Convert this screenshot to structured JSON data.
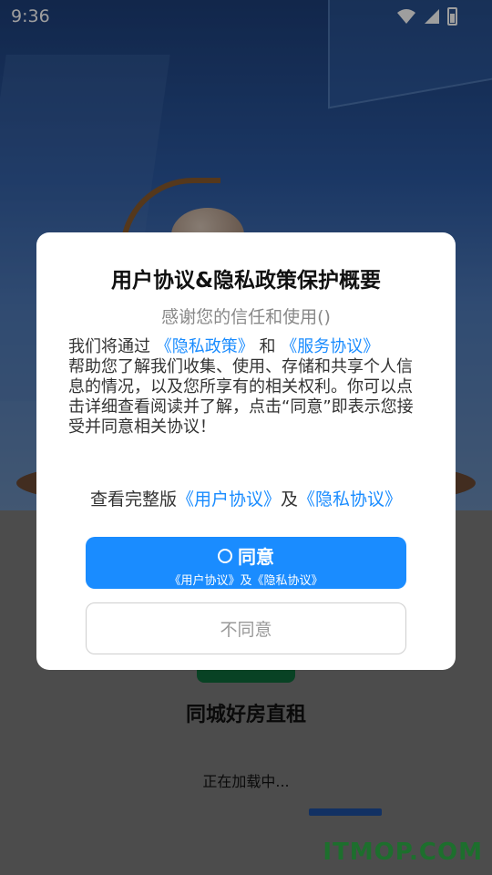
{
  "status_bar": {
    "time": "9:36",
    "icons": [
      "wifi-icon",
      "signal-icon",
      "battery-icon"
    ]
  },
  "splash": {
    "app_name": "同城好房直租",
    "loading_text": "正在加载中...",
    "loading_progress": 0.5
  },
  "dialog": {
    "title": "用户协议&隐私政策保护概要",
    "subtitle": "感谢您的信任和使用()",
    "body_prefix": "我们将通过",
    "privacy_policy_link": "《隐私政策》",
    "and_text": "和",
    "service_agreement_link": "《服务协议》",
    "body_rest": "帮助您了解我们收集、使用、存储和共享个人信息的情况，以及您所享有的相关权利。你可以点击详细查看阅读并了解，点击“同意”即表示您接受并同意相关协议！",
    "more_prefix": "查看完整版",
    "user_agreement_link": "《用户协议》",
    "more_and": "及",
    "privacy_agreement_link": "《隐私协议》",
    "agree_button": {
      "label": "同意",
      "sub": "《用户协议》及《隐私协议》"
    },
    "disagree_button": "不同意"
  },
  "watermark": "ITMOP.COM",
  "colors": {
    "accent": "#1a8cff",
    "watermark": "#2fb34a"
  }
}
